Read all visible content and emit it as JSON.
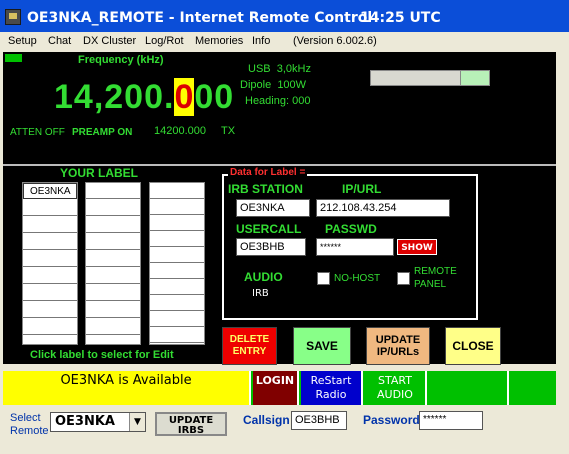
{
  "window": {
    "title": "OE3NKA_REMOTE  -  Internet Remote Control",
    "clock": "14:25 UTC"
  },
  "menu": [
    "Setup",
    "Chat",
    "DX Cluster",
    "Log/Rot",
    "Memories",
    "Info",
    "(Version 6.002.6)"
  ],
  "radio": {
    "frequency_label": "Frequency (kHz)",
    "freq_main": "14,200.",
    "freq_highlight": "0",
    "freq_tail": "00",
    "mode": "USB",
    "bandwidth": "3,0kHz",
    "antenna": "Dipole",
    "power": "100W",
    "heading_label": "Heading:",
    "heading_value": "000",
    "atten": "ATTEN OFF",
    "preamp": "PREAMP ON",
    "freq_small": "14200.000",
    "tx": "TX",
    "meter_level": 0.25
  },
  "labels": {
    "title": "YOUR LABEL",
    "column1": [
      "OE3NKA",
      "",
      "",
      "",
      "",
      "",
      "",
      "",
      ""
    ],
    "hint": "Click label to select for Edit"
  },
  "details": {
    "box_title": "Data for Label =",
    "irb_station_label": "IRB STATION",
    "irb_station_value": "OE3NKA",
    "ipurl_label": "IP/URL",
    "ipurl_value": "212.108.43.254",
    "usercall_label": "USERCALL",
    "usercall_value": "OE3BHB",
    "passwd_label": "PASSWD",
    "passwd_value": "******",
    "show_label": "SHOW",
    "audio_label": "AUDIO",
    "audio_value": "IRB",
    "nohost_label": "NO-HOST",
    "remote_panel_label_1": "REMOTE",
    "remote_panel_label_2": "PANEL"
  },
  "actions": {
    "delete_1": "DELETE",
    "delete_2": "ENTRY",
    "save": "SAVE",
    "update_1": "UPDATE",
    "update_2": "IP/URLs",
    "close": "CLOSE"
  },
  "status": {
    "available": "OE3NKA is Available",
    "login": "LOGIN",
    "restart_1": "ReStart",
    "restart_2": "Radio",
    "start_audio_1": "START",
    "start_audio_2": "AUDIO"
  },
  "bottom": {
    "select_1": "Select",
    "select_2": "Remote",
    "select_value": "OE3NKA",
    "update_irbs_1": "UPDATE",
    "update_irbs_2": "IRBS",
    "callsign_label": "Callsign",
    "callsign_value": "OE3BHB",
    "password_label": "Password",
    "password_value": "******"
  },
  "colors": {
    "titlebar": "#0b4ed8",
    "panel": "#000000",
    "text_green": "#33dd33",
    "status_green": "#00c000",
    "available_yellow": "#ffff00",
    "login_dark_red": "#800000",
    "restart_blue": "#0000cc"
  }
}
